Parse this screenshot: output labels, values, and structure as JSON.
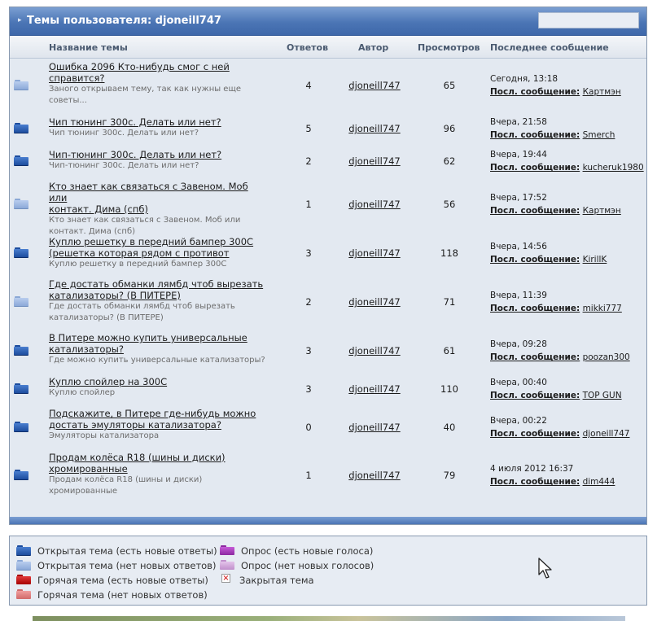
{
  "header": {
    "title": "Темы пользователя: djoneill747"
  },
  "columns": {
    "name": "Название темы",
    "replies": "Ответов",
    "author": "Автор",
    "views": "Просмотров",
    "last": "Последнее сообщение"
  },
  "last_label": "Посл. сообщение:",
  "topics": [
    {
      "title_line1": "Ошибка 2096 Кто-нибудь смог с ней",
      "title_line2": "справится?",
      "desc_line1": "Заного открываем тему, так как нужны еще",
      "desc_line2": "советы...",
      "replies": "4",
      "author": "djoneill747",
      "views": "65",
      "last_time": "Сегодня, 13:18",
      "last_user": "Картмэн",
      "icon": "folder-old"
    },
    {
      "title_line1": "Чип тюнинг 300с. Делать или нет?",
      "title_line2": "",
      "desc_line1": "Чип тюнинг 300с. Делать или нет?",
      "desc_line2": "",
      "replies": "5",
      "author": "djoneill747",
      "views": "96",
      "last_time": "Вчера, 21:58",
      "last_user": "Smerch",
      "icon": "folder-new"
    },
    {
      "title_line1": "Чип-тюнинг 300с. Делать или нет?",
      "title_line2": "",
      "desc_line1": "Чип-тюнинг 300с. Делать или нет?",
      "desc_line2": "",
      "replies": "2",
      "author": "djoneill747",
      "views": "62",
      "last_time": "Вчера, 19:44",
      "last_user": "kucheruk1980",
      "icon": "folder-new"
    },
    {
      "title_line1": "Кто знает как связаться с Завеном. Моб или",
      "title_line2": "контакт. Дима (спб)",
      "desc_line1": "Кто знает как связаться с Завеном. Моб или",
      "desc_line2": "контакт. Дима (спб)",
      "replies": "1",
      "author": "djoneill747",
      "views": "56",
      "last_time": "Вчера, 17:52",
      "last_user": "Картмэн",
      "icon": "folder-old"
    },
    {
      "title_line1": "Куплю решетку в передний бампер 300С",
      "title_line2": "(решетка которая рядом с противот",
      "desc_line1": "Куплю решетку в передний бампер 300С",
      "desc_line2": "",
      "replies": "3",
      "author": "djoneill747",
      "views": "118",
      "last_time": "Вчера, 14:56",
      "last_user": "KirillK",
      "icon": "folder-new"
    },
    {
      "title_line1": "Где достать обманки лямбд чтоб вырезать",
      "title_line2": "катализаторы? (В ПИТЕРЕ)",
      "desc_line1": "Где достать обманки лямбд чтоб вырезать",
      "desc_line2": "катализаторы? (В ПИТЕРЕ)",
      "replies": "2",
      "author": "djoneill747",
      "views": "71",
      "last_time": "Вчера, 11:39",
      "last_user": "mikki777",
      "icon": "folder-old"
    },
    {
      "title_line1": "В Питере можно купить универсальные",
      "title_line2": "катализаторы?",
      "desc_line1": "Где можно купить универсальные катализаторы?",
      "desc_line2": "",
      "replies": "3",
      "author": "djoneill747",
      "views": "61",
      "last_time": "Вчера, 09:28",
      "last_user": "poozan300",
      "icon": "folder-new"
    },
    {
      "title_line1": "Куплю спойлер на 300С",
      "title_line2": "",
      "desc_line1": "Куплю спойлер",
      "desc_line2": "",
      "replies": "3",
      "author": "djoneill747",
      "views": "110",
      "last_time": "Вчера, 00:40",
      "last_user": "TOP GUN",
      "icon": "folder-new"
    },
    {
      "title_line1": "Подскажите, в Питере где-нибудь можно",
      "title_line2": "достать эмуляторы катализатора?",
      "desc_line1": "Эмуляторы катализатора",
      "desc_line2": "",
      "replies": "0",
      "author": "djoneill747",
      "views": "40",
      "last_time": "Вчера, 00:22",
      "last_user": "djoneill747",
      "icon": "folder-new"
    },
    {
      "title_line1": "Продам колёса R18 (шины и диски)",
      "title_line2": "хромированные",
      "desc_line1": "Продам колёса R18 (шины и диски)",
      "desc_line2": "хромированные",
      "replies": "1",
      "author": "djoneill747",
      "views": "79",
      "last_time": "4 июля 2012 16:37",
      "last_user": "dim444",
      "icon": "folder-new"
    }
  ],
  "legend": {
    "open_new": "Открытая тема (есть новые ответы)",
    "open_old": "Открытая тема (нет новых ответов)",
    "hot_new": "Горячая тема (есть новые ответы)",
    "hot_old": "Горячая тема (нет новых ответов)",
    "poll_new": "Опрос (есть новые голоса)",
    "poll_old": "Опрос (нет новых голосов)",
    "closed": "Закрытая тема"
  }
}
